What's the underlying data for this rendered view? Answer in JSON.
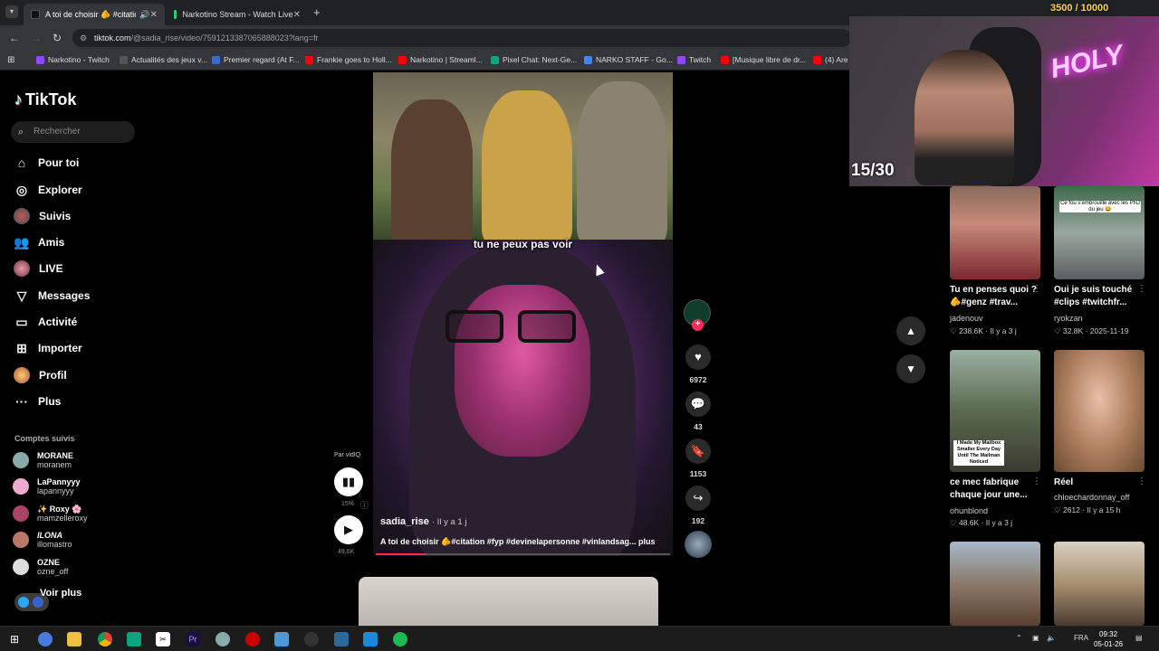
{
  "browser": {
    "tabs": [
      {
        "title": "A toi de choisir 🫵 #citation",
        "active": true
      },
      {
        "title": "Narkotino Stream - Watch Live",
        "active": false
      }
    ],
    "url_host": "tiktok.com",
    "url_path": "/@sadia_rise/video/7591213387065888023?lang=fr",
    "bookmarks": [
      "Narkotino - Twitch",
      "Actualités des jeux v...",
      "Premier regard (At F...",
      "Frankie goes to Holl...",
      "Narkotino | Streaml...",
      "Pixel Chat: Next-Ge...",
      "NARKO STAFF - Go...",
      "Twitch",
      "[Musique libre de dr...",
      "(4) Are"
    ]
  },
  "tiktok": {
    "logo": "TikTok",
    "search_placeholder": "Rechercher",
    "nav": [
      {
        "label": "Pour toi",
        "icon": "home-icon"
      },
      {
        "label": "Explorer",
        "icon": "compass-icon"
      },
      {
        "label": "Suivis",
        "icon": "avatar-icon"
      },
      {
        "label": "Amis",
        "icon": "friends-icon"
      },
      {
        "label": "LIVE",
        "icon": "avatar-icon"
      },
      {
        "label": "Messages",
        "icon": "send-icon"
      },
      {
        "label": "Activité",
        "icon": "inbox-icon"
      },
      {
        "label": "Importer",
        "icon": "upload-icon"
      },
      {
        "label": "Profil",
        "icon": "avatar-icon"
      },
      {
        "label": "Plus",
        "icon": "more-icon"
      }
    ],
    "accounts_title": "Comptes suivis",
    "accounts": [
      {
        "display": "MORANE",
        "handle": "moranem"
      },
      {
        "display": "LaPannyyy",
        "handle": "lapannyyy"
      },
      {
        "display": "✨ Roxy 🌸",
        "handle": "mamzelleroxy"
      },
      {
        "display": "ILONA",
        "handle": "illomastro"
      },
      {
        "display": "OZNE",
        "handle": "ozne_off"
      }
    ],
    "see_more": "Voir plus"
  },
  "video": {
    "caption": "tu ne peux pas voir",
    "author": "sadia_rise",
    "time": "· Il y a 1 j",
    "description": "A toi de choisir 🫵#citation #fyp #devinelapersonne #vinlandsag...",
    "more": "plus",
    "progress": 0.17,
    "poll_by": "Par vidIQ",
    "poll_pct": "15%",
    "views": "49,6K"
  },
  "actions": {
    "likes": "6972",
    "comments": "43",
    "saves": "1153",
    "shares": "192"
  },
  "stream": {
    "counter": "15/30",
    "top_badge": "3500 / 10000",
    "neon_text": "HOLY"
  },
  "recommendations": [
    {
      "title": "Tu en penses quoi ? 🫵#genz #trav...",
      "author": "jadenouv",
      "likes": "238.6K",
      "date": "Il y a 3 j",
      "thumb_text": ""
    },
    {
      "title": "Oui je suis touché #clips #twitchfr...",
      "author": "ryokzan",
      "likes": "32.8K",
      "date": "2025-11-19",
      "thumb_text": "Ce fou s'embrouille avec les PNJ du jeu 😂"
    },
    {
      "title": "ce mec fabrique chaque jour une...",
      "author": "ohunblond",
      "likes": "48.6K",
      "date": "Il y a 3 j",
      "thumb_text": "I Made My Mailbox Smaller Every Day Until The Mailman Noticed"
    },
    {
      "title": "Réel",
      "author": "chloechardonnay_off",
      "likes": "2612",
      "date": "Il y a 15 h",
      "thumb_text": ""
    }
  ],
  "taskbar": {
    "lang": "FRA",
    "time": "09:32",
    "date": "05-01-26"
  }
}
